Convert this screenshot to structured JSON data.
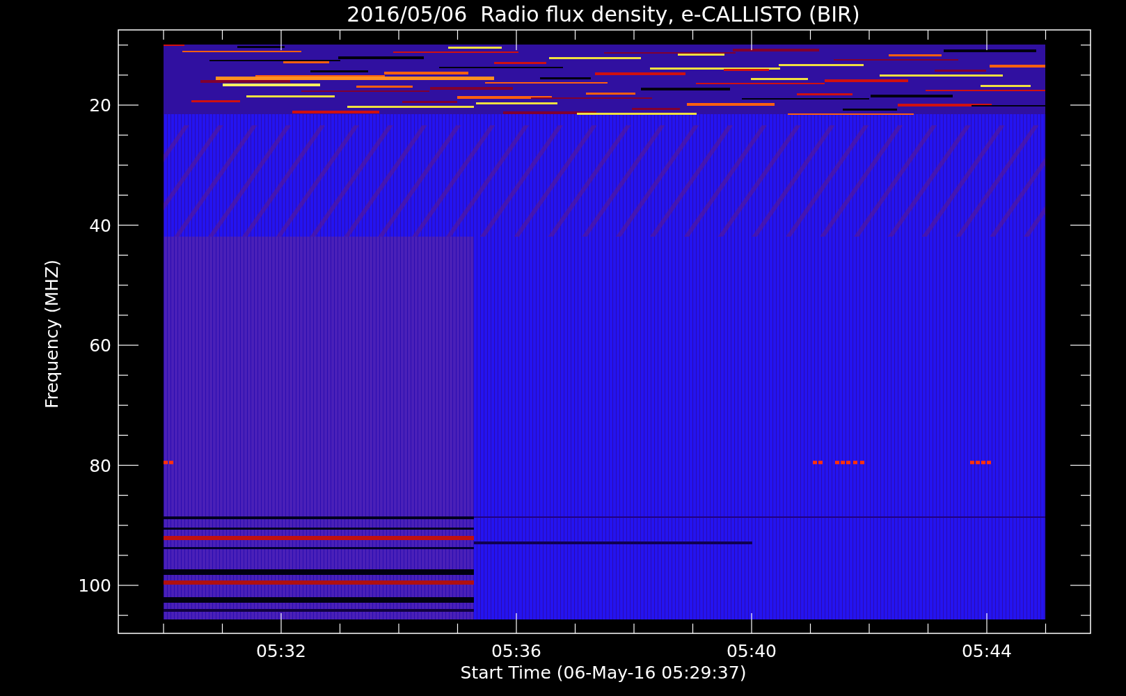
{
  "plot": {
    "title": "2016/05/06  Radio flux density, e-CALLISTO (BIR)",
    "ylabel": "Frequency (MHZ)",
    "xlabel": "Start Time (06-May-16 05:29:37)",
    "yticks": [
      "20",
      "40",
      "60",
      "80",
      "100"
    ],
    "xticks": [
      "05:32",
      "05:36",
      "05:40",
      "05:44"
    ]
  }
}
